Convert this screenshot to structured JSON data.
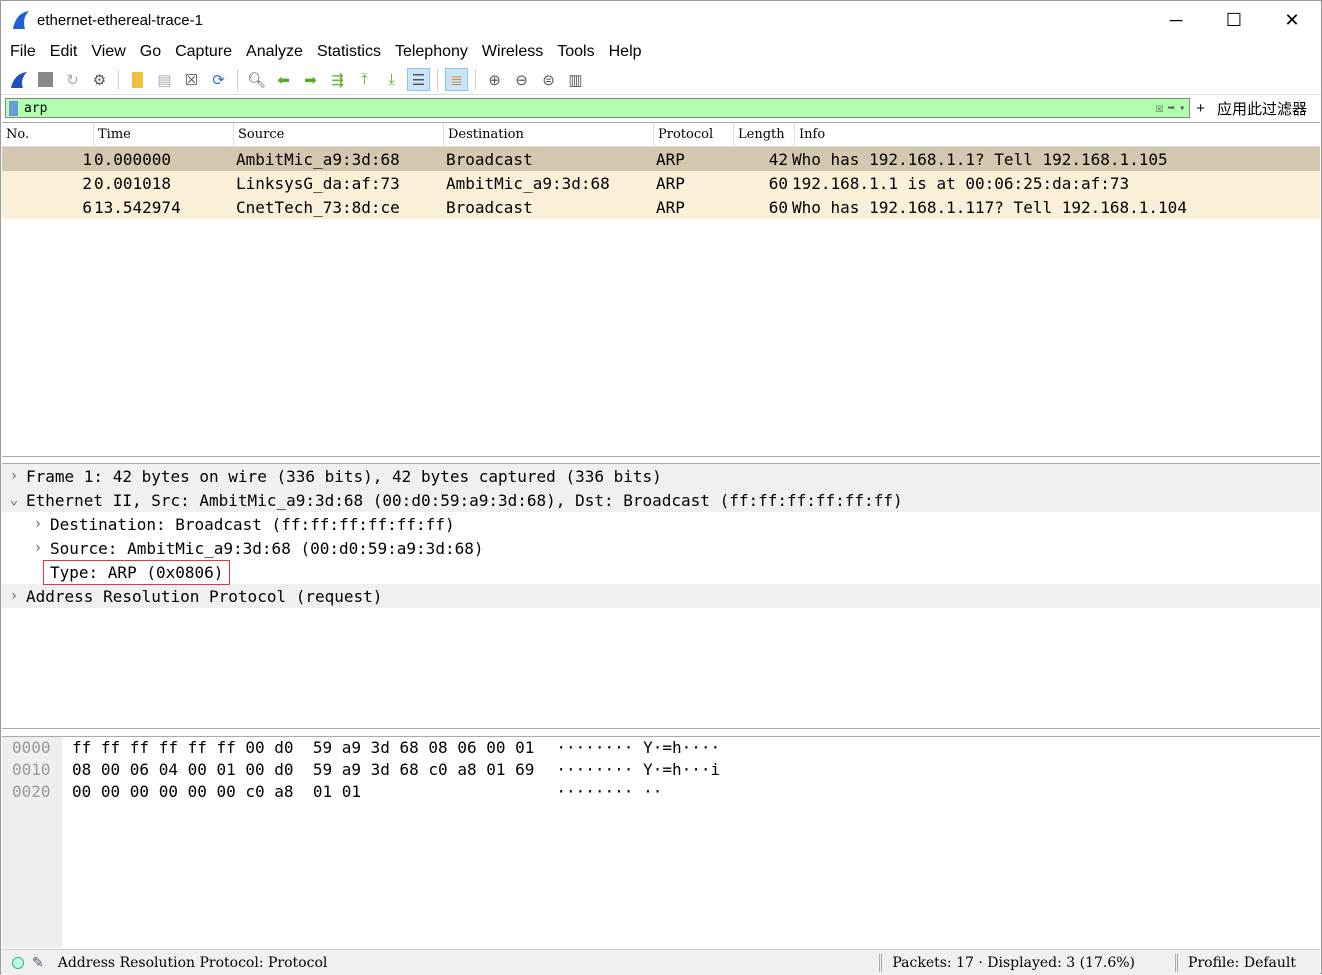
{
  "window": {
    "title": "ethernet-ethereal-trace-1",
    "min": "─",
    "max": "☐",
    "close": "✕"
  },
  "menu": [
    "File",
    "Edit",
    "View",
    "Go",
    "Capture",
    "Analyze",
    "Statistics",
    "Telephony",
    "Wireless",
    "Tools",
    "Help"
  ],
  "toolbar": [
    "start-capture",
    "stop-capture",
    "restart-capture",
    "capture-options",
    "open-file",
    "save-file",
    "close-file",
    "reload-file",
    "find-packet",
    "go-back",
    "go-forward",
    "go-to-packet",
    "go-first",
    "go-last",
    "auto-scroll",
    "colorize",
    "zoom-in",
    "zoom-out",
    "zoom-normal",
    "resize-columns"
  ],
  "filter": {
    "value": "arp",
    "apply_label": "应用此过滤器",
    "plus": "+"
  },
  "packet_list": {
    "columns": [
      "No.",
      "Time",
      "Source",
      "Destination",
      "Protocol",
      "Length",
      "Info"
    ],
    "rows": [
      {
        "no": "1",
        "time": "0.000000",
        "src": "AmbitMic_a9:3d:68",
        "dst": "Broadcast",
        "proto": "ARP",
        "len": "42",
        "info": "Who has 192.168.1.1? Tell 192.168.1.105"
      },
      {
        "no": "2",
        "time": "0.001018",
        "src": "LinksysG_da:af:73",
        "dst": "AmbitMic_a9:3d:68",
        "proto": "ARP",
        "len": "60",
        "info": "192.168.1.1 is at 00:06:25:da:af:73"
      },
      {
        "no": "6",
        "time": "13.542974",
        "src": "CnetTech_73:8d:ce",
        "dst": "Broadcast",
        "proto": "ARP",
        "len": "60",
        "info": "Who has 192.168.1.117? Tell 192.168.1.104"
      }
    ]
  },
  "details": [
    "Frame 1: 42 bytes on wire (336 bits), 42 bytes captured (336 bits)",
    "Ethernet II, Src: AmbitMic_a9:3d:68 (00:d0:59:a9:3d:68), Dst: Broadcast (ff:ff:ff:ff:ff:ff)",
    "Destination: Broadcast (ff:ff:ff:ff:ff:ff)",
    "Source: AmbitMic_a9:3d:68 (00:d0:59:a9:3d:68)",
    "Type: ARP (0x0806)",
    "Address Resolution Protocol (request)"
  ],
  "bytes": {
    "offsets": [
      "0000",
      "0010",
      "0020"
    ],
    "hex": [
      "ff ff ff ff ff ff 00 d0  59 a9 3d 68 08 06 00 01",
      "08 00 06 04 00 01 00 d0  59 a9 3d 68 c0 a8 01 69",
      "00 00 00 00 00 00 c0 a8  01 01"
    ],
    "ascii": [
      "········ Y·=h····",
      "········ Y·=h···i",
      "········ ··"
    ]
  },
  "status": {
    "field": "Address Resolution Protocol: Protocol",
    "packets": "Packets: 17 · Displayed: 3 (17.6%)",
    "profile": "Profile: Default"
  }
}
